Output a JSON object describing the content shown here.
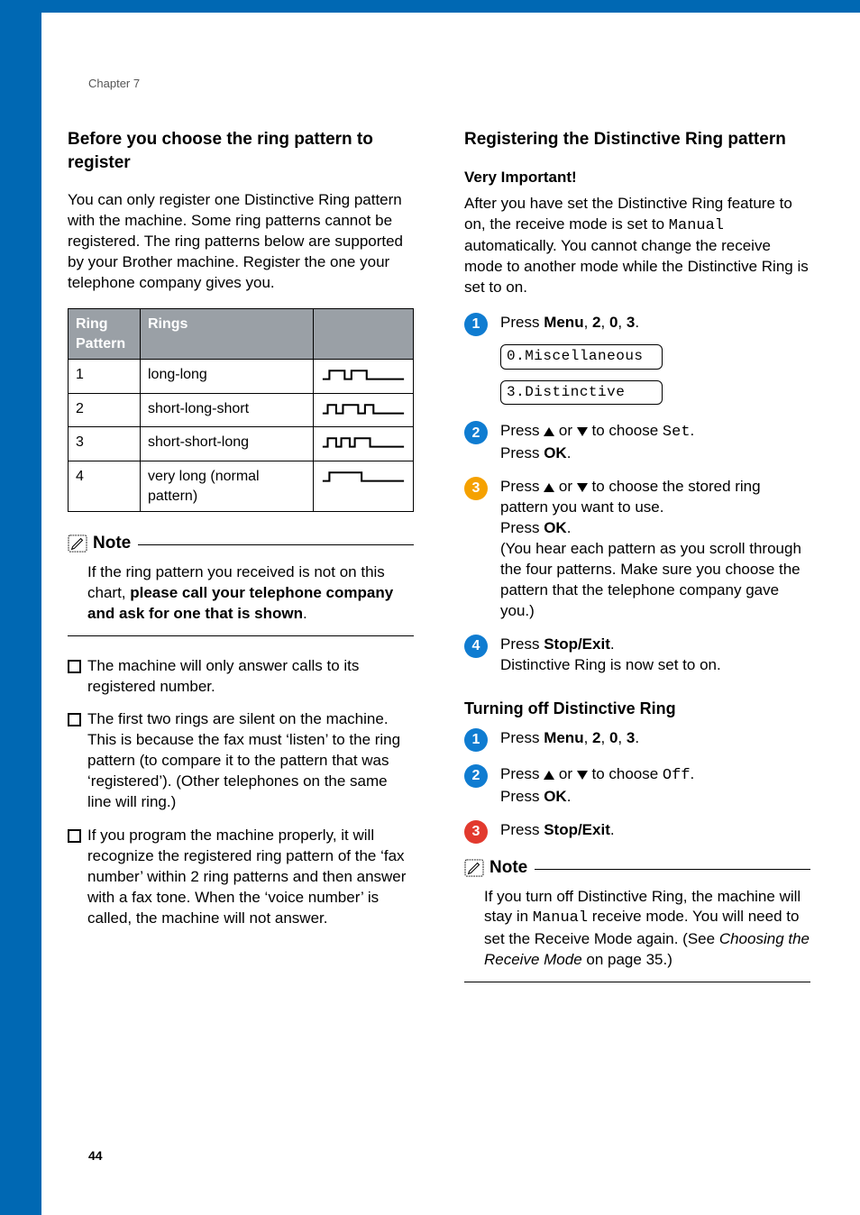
{
  "chapter_label": "Chapter 7",
  "page_number": "44",
  "left": {
    "heading": "Before you choose the ring pattern to register",
    "intro": "You can only register one Distinctive Ring pattern with the machine. Some ring patterns cannot be registered. The ring patterns below are supported by your Brother machine. Register the one your telephone company gives you.",
    "table": {
      "headers": [
        "Ring Pattern",
        "Rings",
        ""
      ],
      "rows": [
        {
          "pattern": "1",
          "rings": "long-long"
        },
        {
          "pattern": "2",
          "rings": "short-long-short"
        },
        {
          "pattern": "3",
          "rings": "short-short-long"
        },
        {
          "pattern": "4",
          "rings": "very long (normal pattern)"
        }
      ]
    },
    "note": {
      "label": "Note",
      "text_prefix": "If the ring pattern you received is not on this chart, ",
      "text_bold": "please call your telephone company and ask for one that is shown",
      "text_suffix": "."
    },
    "bullets": [
      "The machine will only answer calls to its registered number.",
      "The first two rings are silent on the machine. This is because the fax must ‘listen’ to the ring pattern (to compare it to the pattern that was ‘registered’). (Other telephones on the same line will ring.)",
      "If you program the machine properly, it will recognize the registered ring pattern of the ‘fax number’ within 2 ring patterns and then answer with a fax tone. When the ‘voice number’ is called, the machine will not answer."
    ]
  },
  "right": {
    "heading": "Registering the Distinctive Ring pattern",
    "subhead": "Very Important!",
    "intro_pre": "After you have set the Distinctive Ring feature to on, the receive mode is set to ",
    "intro_mono": "Manual",
    "intro_post": " automatically. You cannot change the receive mode to another mode while the Distinctive Ring is set to on.",
    "lcd1": "0.Miscellaneous",
    "lcd2": "3.Distinctive",
    "steps_register": [
      {
        "color": "#0f7cd1",
        "num": "1",
        "html": [
          {
            "t": "text",
            "v": "Press "
          },
          {
            "t": "bold",
            "v": "Menu"
          },
          {
            "t": "text",
            "v": ", "
          },
          {
            "t": "bold",
            "v": "2"
          },
          {
            "t": "text",
            "v": ", "
          },
          {
            "t": "bold",
            "v": "0"
          },
          {
            "t": "text",
            "v": ", "
          },
          {
            "t": "bold",
            "v": "3"
          },
          {
            "t": "text",
            "v": "."
          }
        ],
        "show_lcd": true
      },
      {
        "color": "#0f7cd1",
        "num": "2",
        "lines": [
          [
            {
              "t": "text",
              "v": "Press "
            },
            {
              "t": "arrow-up"
            },
            {
              "t": "text",
              "v": " or "
            },
            {
              "t": "arrow-down"
            },
            {
              "t": "text",
              "v": " to choose "
            },
            {
              "t": "mono",
              "v": "Set"
            },
            {
              "t": "text",
              "v": "."
            }
          ],
          [
            {
              "t": "text",
              "v": "Press "
            },
            {
              "t": "bold",
              "v": "OK"
            },
            {
              "t": "text",
              "v": "."
            }
          ]
        ]
      },
      {
        "color": "#f5a100",
        "num": "3",
        "lines": [
          [
            {
              "t": "text",
              "v": "Press "
            },
            {
              "t": "arrow-up"
            },
            {
              "t": "text",
              "v": " or "
            },
            {
              "t": "arrow-down"
            },
            {
              "t": "text",
              "v": " to choose the stored ring pattern you want to use."
            }
          ],
          [
            {
              "t": "text",
              "v": "Press "
            },
            {
              "t": "bold",
              "v": "OK"
            },
            {
              "t": "text",
              "v": "."
            }
          ],
          [
            {
              "t": "text",
              "v": "(You hear each pattern as you scroll through the four patterns. Make sure you choose the pattern that the telephone company gave you.)"
            }
          ]
        ]
      },
      {
        "color": "#0f7cd1",
        "num": "4",
        "lines": [
          [
            {
              "t": "text",
              "v": "Press "
            },
            {
              "t": "bold",
              "v": "Stop/Exit"
            },
            {
              "t": "text",
              "v": "."
            }
          ],
          [
            {
              "t": "text",
              "v": "Distinctive Ring is now set to on."
            }
          ]
        ]
      }
    ],
    "turnoff_heading": "Turning off Distinctive Ring",
    "steps_off": [
      {
        "color": "#0f7cd1",
        "num": "1",
        "lines": [
          [
            {
              "t": "text",
              "v": "Press "
            },
            {
              "t": "bold",
              "v": "Menu"
            },
            {
              "t": "text",
              "v": ", "
            },
            {
              "t": "bold",
              "v": "2"
            },
            {
              "t": "text",
              "v": ", "
            },
            {
              "t": "bold",
              "v": "0"
            },
            {
              "t": "text",
              "v": ", "
            },
            {
              "t": "bold",
              "v": "3"
            },
            {
              "t": "text",
              "v": "."
            }
          ]
        ]
      },
      {
        "color": "#0f7cd1",
        "num": "2",
        "lines": [
          [
            {
              "t": "text",
              "v": "Press "
            },
            {
              "t": "arrow-up"
            },
            {
              "t": "text",
              "v": " or "
            },
            {
              "t": "arrow-down"
            },
            {
              "t": "text",
              "v": " to choose "
            },
            {
              "t": "mono",
              "v": "Off"
            },
            {
              "t": "text",
              "v": "."
            }
          ],
          [
            {
              "t": "text",
              "v": "Press "
            },
            {
              "t": "bold",
              "v": "OK"
            },
            {
              "t": "text",
              "v": "."
            }
          ]
        ]
      },
      {
        "color": "#e23a2e",
        "num": "3",
        "lines": [
          [
            {
              "t": "text",
              "v": "Press "
            },
            {
              "t": "bold",
              "v": "Stop/Exit"
            },
            {
              "t": "text",
              "v": "."
            }
          ]
        ]
      }
    ],
    "note2": {
      "label": "Note",
      "pre": "If you turn off Distinctive Ring, the machine will stay in ",
      "mono": "Manual",
      "mid": " receive mode. You will need to set the Receive Mode again. (See ",
      "italic": "Choosing the Receive Mode",
      "post": " on page 35.)"
    }
  }
}
